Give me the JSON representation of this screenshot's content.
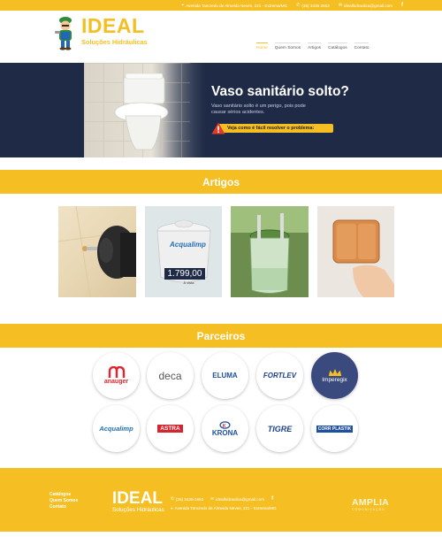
{
  "topbar": {
    "address": "Avenida Tancredo de Almeida Neves, 221 - Extrema/MG",
    "phone": "(35) 3435-2653",
    "email": "idealhidraulica@gmail.com",
    "social_icon": "facebook-icon"
  },
  "header": {
    "brand": "IDEAL",
    "tagline": "Soluções Hidráulicas",
    "nav": [
      {
        "label": "Home",
        "active": true
      },
      {
        "label": "Quem Somos",
        "active": false
      },
      {
        "label": "Artigos",
        "active": false
      },
      {
        "label": "Catálogos",
        "active": false
      },
      {
        "label": "Contato",
        "active": false
      }
    ]
  },
  "hero": {
    "title": "Vaso sanitário solto?",
    "subtitle": "Vaso sanitário solto é um perigo, pois pode causar sérios acidentes.",
    "cta": "Veja como é fácil resolver o problema:"
  },
  "sections": {
    "articles_title": "Artigos",
    "partners_title": "Parceiros"
  },
  "articles": [
    {
      "name": "drill-wall-article"
    },
    {
      "name": "water-tank-article",
      "price": "1.799,00",
      "price_note": "À vista"
    },
    {
      "name": "cistern-article"
    },
    {
      "name": "flush-button-article"
    }
  ],
  "partners": [
    "anauger",
    "deca",
    "ELUMA",
    "FORTLEV",
    "Imperegix",
    "Acqualimp",
    "ASTRA",
    "KRONA",
    "TIGRE",
    "CORR PLASTIK"
  ],
  "footer": {
    "links": [
      "Catálogos",
      "Quem Somos",
      "Contato"
    ],
    "brand": "IDEAL",
    "tagline": "Soluções Hidráulicas",
    "phone": "(35) 3435-2653",
    "email": "idealhidraulica@gmail.com",
    "address": "Avenida Tancredo de Almeida Neves, 221 - Extrema/MG",
    "agency": "AMPLIA",
    "agency_sub": "COMUNICAÇÃO"
  },
  "colors": {
    "accent": "#f5bf23",
    "hero_bg": "#1e2a46"
  }
}
